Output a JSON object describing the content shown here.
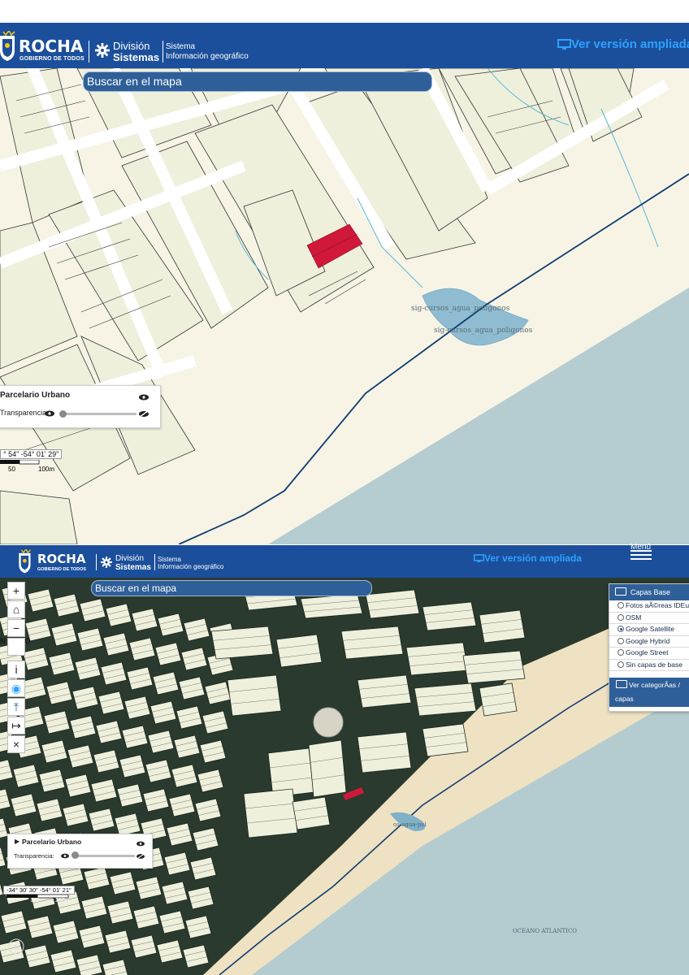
{
  "top_view": {
    "header": {
      "logo_text": "ROCHA",
      "logo_sub": "GOBIERNO DE TODOS",
      "division_line1": "División",
      "division_line2": "Sistemas",
      "sistema_line1": "Sistema",
      "sistema_line2": "Información geográfico",
      "ver_link": "Ver versión ampliada"
    },
    "search_placeholder": "Buscar en el mapa",
    "layer_panel": {
      "title": "Parcelario Urbano",
      "transparency_label": "Transparencia:"
    },
    "coords": "° 54\" -54° 01' 29\"",
    "scale_labels": [
      "50",
      "100m"
    ],
    "map_labels": [
      "sig-cursos_agua_poligonos",
      "sig-cursos_agua_poligonos"
    ],
    "colors": {
      "header": "#1b4f9b",
      "parcel": "#eef0dc",
      "street": "#ffffff",
      "sand": "#f7f4e6",
      "ocean": "#b5cdd0",
      "highlight": "#d0183a",
      "line": "#0f3c72"
    }
  },
  "bottom_view": {
    "header": {
      "logo_text": "ROCHA",
      "logo_sub": "GOBIERNO DE TODOS",
      "division_line1": "División",
      "division_line2": "Sistemas",
      "sistema_line1": "Sistema",
      "sistema_line2": "Información geográfico",
      "ver_link": "Ver versión ampliada",
      "menu_label": "Menú"
    },
    "search_placeholder": "Buscar en el mapa",
    "toolbar_buttons": [
      "+",
      "⌂",
      "−",
      "",
      "i",
      "◉",
      "⤒",
      "↦",
      "×"
    ],
    "place_label": "N CISCO",
    "base_layers": {
      "title": "Capas Base",
      "options": [
        {
          "label": "Fotos aÃ©reas IDEuy",
          "selected": false
        },
        {
          "label": "OSM",
          "selected": false
        },
        {
          "label": "Google Satellite",
          "selected": true
        },
        {
          "label": "Google Hybrid",
          "selected": false
        },
        {
          "label": "Google Street",
          "selected": false
        },
        {
          "label": "Sin capas de base",
          "selected": false
        }
      ],
      "categories_line1": "Ver categorÃas /",
      "categories_line2": "capas"
    },
    "layer_panel": {
      "title": "Parcelario Urbano",
      "transparency_label": "Transparencia:"
    },
    "coords": "-34° 30' 30\" -54° 01' 21\"",
    "scale_labels": [
      "0",
      "100",
      "200m"
    ],
    "map_labels": [
      "os-agua-pol",
      "OCEANO ATLANTICO"
    ],
    "compass_label": "N"
  }
}
